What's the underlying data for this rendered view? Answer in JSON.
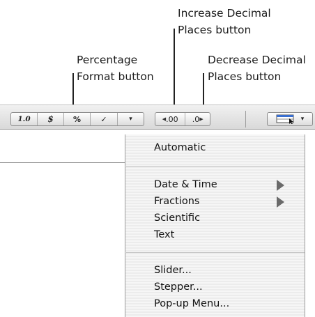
{
  "callouts": {
    "increase_line1": "Increase Decimal",
    "increase_line2": "Places button",
    "percentage_line1": "Percentage",
    "percentage_line2": "Format button",
    "decrease_line1": "Decrease Decimal",
    "decrease_line2": "Places button"
  },
  "toolbar": {
    "number_format_label": "1.0",
    "currency_label": "$",
    "percent_label": "%",
    "checkbox_label": "✓",
    "more_formats_label": "▾",
    "increase_decimal_label": ".00",
    "decrease_decimal_label": ".0",
    "cell_control_dropdown_label": "▾"
  },
  "menu": {
    "items": [
      {
        "label": "Automatic"
      },
      {
        "label": "Date & Time"
      },
      {
        "label": "Fractions"
      },
      {
        "label": "Scientific"
      },
      {
        "label": "Text"
      },
      {
        "label": "Slider..."
      },
      {
        "label": "Stepper..."
      },
      {
        "label": "Pop-up Menu..."
      }
    ]
  }
}
